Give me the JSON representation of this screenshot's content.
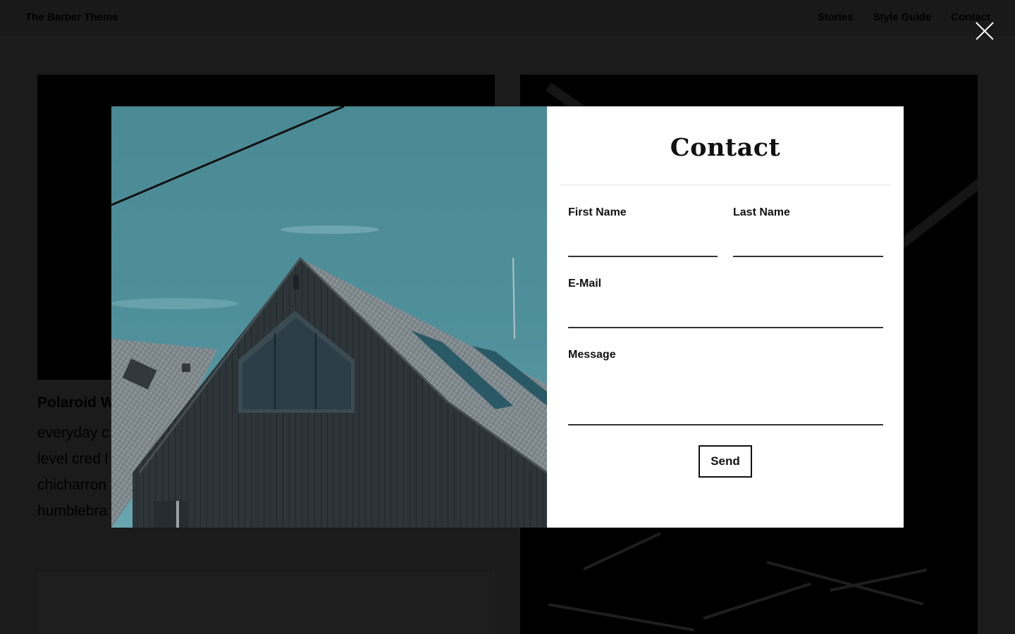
{
  "header": {
    "site_title": "The Barber Theme",
    "nav": [
      "Stories",
      "Style Guide",
      "Contact"
    ]
  },
  "background_card": {
    "title": "Polaroid W",
    "lines": [
      "everyday c",
      "level cred l",
      "chicharron",
      "humblebra"
    ]
  },
  "modal": {
    "title": "Contact",
    "fields": {
      "first_name": {
        "label": "First Name",
        "value": ""
      },
      "last_name": {
        "label": "Last Name",
        "value": ""
      },
      "email": {
        "label": "E-Mail",
        "value": ""
      },
      "message": {
        "label": "Message",
        "value": ""
      }
    },
    "submit_label": "Send",
    "image_subject": "house-roof-photo"
  },
  "colors": {
    "overlay_bg": "#1b1b1b",
    "sky": "#4e8c96",
    "house": "#2b3236",
    "form_bg": "#ffffff"
  }
}
